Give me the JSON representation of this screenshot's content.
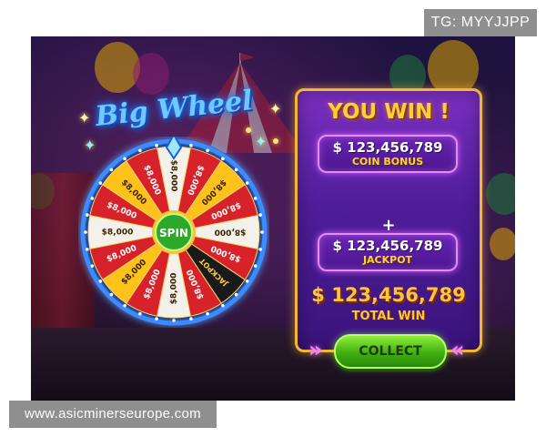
{
  "watermarks": {
    "telegram": "TG: MYYJJPP",
    "website": "www.asicminerseurope.com"
  },
  "game": {
    "title": "Big Wheel",
    "wheel": {
      "center_label": "SPIN",
      "segments": [
        "$8,000",
        "$8,000",
        "$8,000",
        "$8,000",
        "$8,000",
        "$8,000",
        "JACKPOT",
        "$8,000",
        "$8,000",
        "$8,000",
        "$8,000",
        "$8,000",
        "$8,000",
        "$8,000",
        "$8,000",
        "$8,000"
      ],
      "colors": {
        "red": "#d8222a",
        "yellow": "#ffc21a",
        "white": "#f4f1ea",
        "jackpot": "#1a1a1a",
        "rim": "#2a6cff"
      }
    }
  },
  "win_panel": {
    "heading": "YOU WIN !",
    "coin_bonus": {
      "amount": "$ 123,456,789",
      "label": "COIN BONUS"
    },
    "operator": "+",
    "jackpot": {
      "amount": "$ 123,456,789",
      "label": "JACKPOT"
    },
    "total": {
      "amount": "$ 123,456,789",
      "label": "TOTAL WIN"
    },
    "collect_label": "COLLECT",
    "colors": {
      "border": "#f2b630",
      "panel": "#5a22a8",
      "gold_text": "#ffc53a",
      "button": "#3fae12"
    }
  }
}
